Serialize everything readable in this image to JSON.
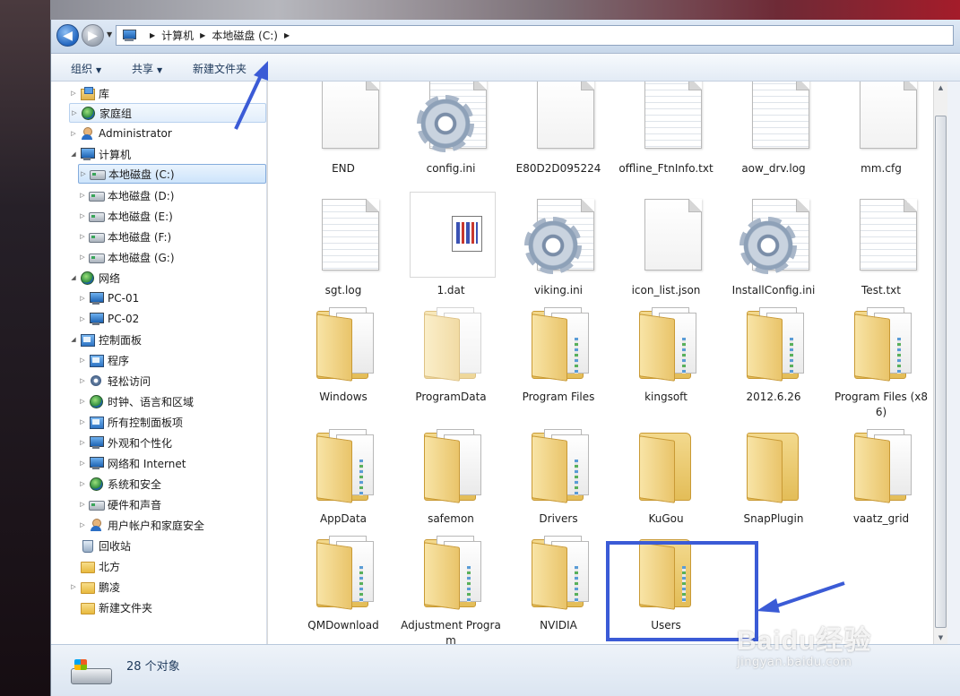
{
  "address": {
    "crumbs": [
      "计算机",
      "本地磁盘 (C:)"
    ]
  },
  "toolbar": {
    "organize_label": "组织",
    "share_label": "共享",
    "new_folder_label": "新建文件夹"
  },
  "nav_tree": {
    "items": [
      {
        "label": "库",
        "icon": "library-icon"
      },
      {
        "label": "家庭组",
        "icon": "homegroup-icon"
      },
      {
        "label": "Administrator",
        "icon": "user-icon"
      },
      {
        "label": "计算机",
        "icon": "computer-icon"
      },
      {
        "label": "本地磁盘 (C:)",
        "icon": "drive-icon",
        "selected": true
      },
      {
        "label": "本地磁盘 (D:)",
        "icon": "drive-icon"
      },
      {
        "label": "本地磁盘 (E:)",
        "icon": "drive-icon"
      },
      {
        "label": "本地磁盘 (F:)",
        "icon": "drive-icon"
      },
      {
        "label": "本地磁盘 (G:)",
        "icon": "drive-icon"
      },
      {
        "label": "网络",
        "icon": "network-icon"
      },
      {
        "label": "PC-01",
        "icon": "computer-icon"
      },
      {
        "label": "PC-02",
        "icon": "computer-icon"
      },
      {
        "label": "控制面板",
        "icon": "control-panel-icon"
      },
      {
        "label": "程序",
        "icon": "programs-icon"
      },
      {
        "label": "轻松访问",
        "icon": "ease-of-access-icon"
      },
      {
        "label": "时钟、语言和区域",
        "icon": "clock-language-icon"
      },
      {
        "label": "所有控制面板项",
        "icon": "control-panel-icon"
      },
      {
        "label": "外观和个性化",
        "icon": "appearance-icon"
      },
      {
        "label": "网络和 Internet",
        "icon": "network-internet-icon"
      },
      {
        "label": "系统和安全",
        "icon": "system-security-icon"
      },
      {
        "label": "硬件和声音",
        "icon": "hardware-sound-icon"
      },
      {
        "label": "用户帐户和家庭安全",
        "icon": "user-accounts-icon"
      },
      {
        "label": "回收站",
        "icon": "recycle-bin-icon"
      },
      {
        "label": "北方",
        "icon": "folder-icon"
      },
      {
        "label": "鹏凌",
        "icon": "folder-icon"
      },
      {
        "label": "新建文件夹",
        "icon": "folder-icon"
      }
    ]
  },
  "files": {
    "row1": [
      {
        "label": "END",
        "type": "blank-file"
      },
      {
        "label": "config.ini",
        "type": "settings-file"
      },
      {
        "label": "E80D2D095224",
        "type": "blank-file"
      },
      {
        "label": "offline_FtnInfo.txt",
        "type": "text-file"
      },
      {
        "label": "aow_drv.log",
        "type": "text-file"
      },
      {
        "label": "mm.cfg",
        "type": "blank-file"
      }
    ],
    "row2": [
      {
        "label": "sgt.log",
        "type": "text-file"
      },
      {
        "label": "1.dat",
        "type": "dat-file"
      },
      {
        "label": "viking.ini",
        "type": "settings-file"
      },
      {
        "label": "icon_list.json",
        "type": "blank-file"
      },
      {
        "label": "InstallConfig.ini",
        "type": "settings-file"
      },
      {
        "label": "Test.txt",
        "type": "text-file"
      }
    ],
    "row3": [
      {
        "label": "Windows",
        "type": "folder"
      },
      {
        "label": "ProgramData",
        "type": "folder"
      },
      {
        "label": "Program Files",
        "type": "folder"
      },
      {
        "label": "kingsoft",
        "type": "folder"
      },
      {
        "label": "2012.6.26",
        "type": "folder"
      },
      {
        "label": "Program Files (x86)",
        "type": "folder"
      }
    ],
    "row4": [
      {
        "label": "AppData",
        "type": "folder"
      },
      {
        "label": "safemon",
        "type": "folder"
      },
      {
        "label": "Drivers",
        "type": "folder"
      },
      {
        "label": "KuGou",
        "type": "folder"
      },
      {
        "label": "SnapPlugin",
        "type": "folder"
      },
      {
        "label": "vaatz_grid",
        "type": "folder"
      }
    ],
    "row5": [
      {
        "label": "QMDownload",
        "type": "folder"
      },
      {
        "label": "Adjustment Program",
        "type": "folder"
      },
      {
        "label": "NVIDIA",
        "type": "folder"
      },
      {
        "label": "Users",
        "type": "folder"
      }
    ]
  },
  "status": {
    "item_count": "28 个对象"
  },
  "watermark": {
    "logo_text": "Baidu经验",
    "url": "jingyan.baidu.com"
  },
  "colors": {
    "annotation_blue": "#3b5bd6",
    "selection_border": "#84acdd"
  }
}
